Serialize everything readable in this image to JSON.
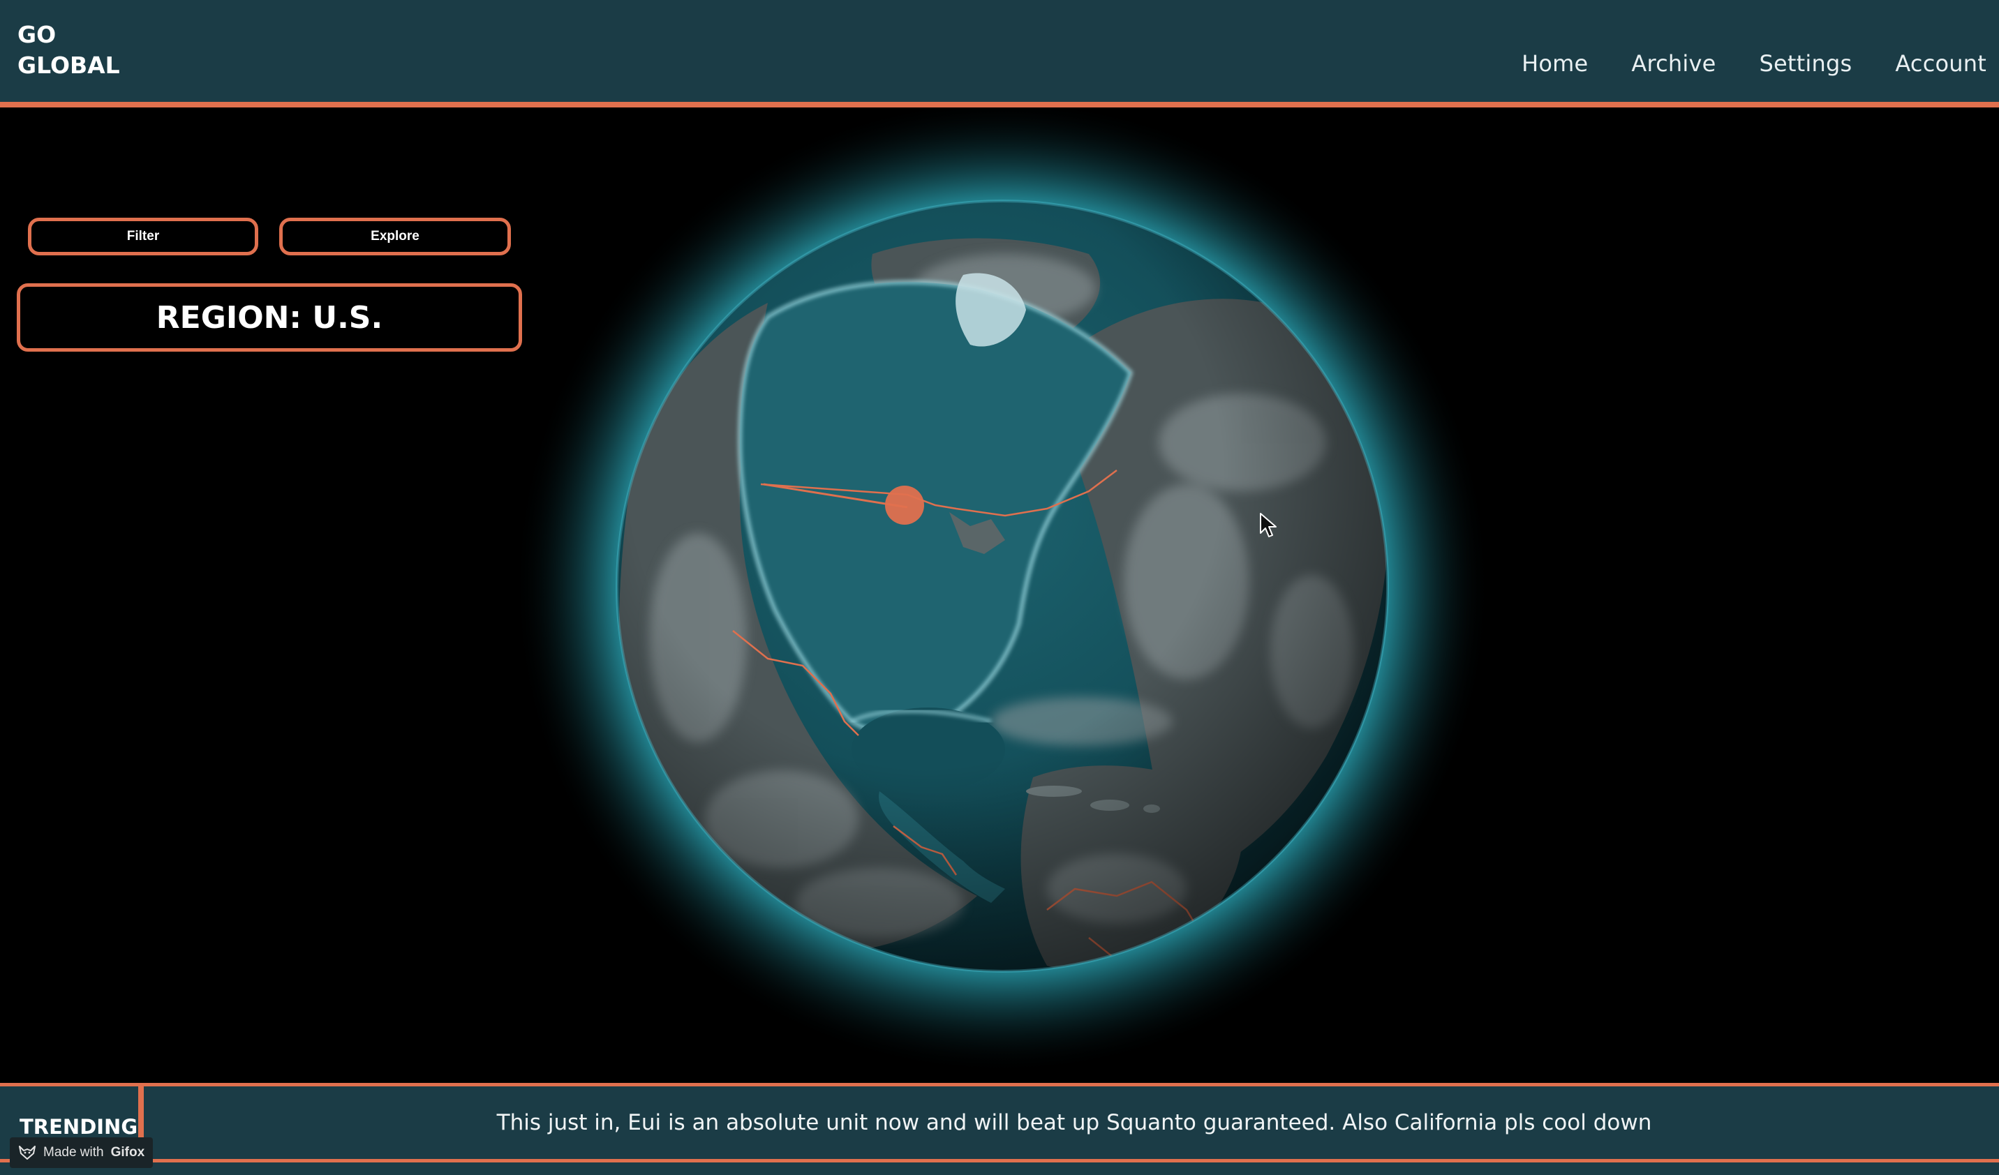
{
  "header": {
    "logo": "GO\nGLOBAL",
    "nav": [
      "Home",
      "Archive",
      "Settings",
      "Account"
    ]
  },
  "controls": {
    "filter_label": "Filter",
    "explore_label": "Explore",
    "region_label": "REGION: U.S."
  },
  "footer": {
    "trending_label": "TRENDING",
    "ticker_text": "This just in, Eui is an absolute unit now and will beat up Squanto guaranteed. Also California pls cool down"
  },
  "watermark": {
    "prefix": "Made with",
    "brand": "Gifox",
    "icon": "fox-icon"
  },
  "colors": {
    "header_bg": "#1b3c46",
    "accent": "#e0704e",
    "globe_ocean": "#0f4a55",
    "globe_glow": "#2aa3b3",
    "marker": "#e0704e"
  },
  "icons": {
    "cursor": "mouse-pointer-icon",
    "globe": "earth-globe-icon"
  }
}
